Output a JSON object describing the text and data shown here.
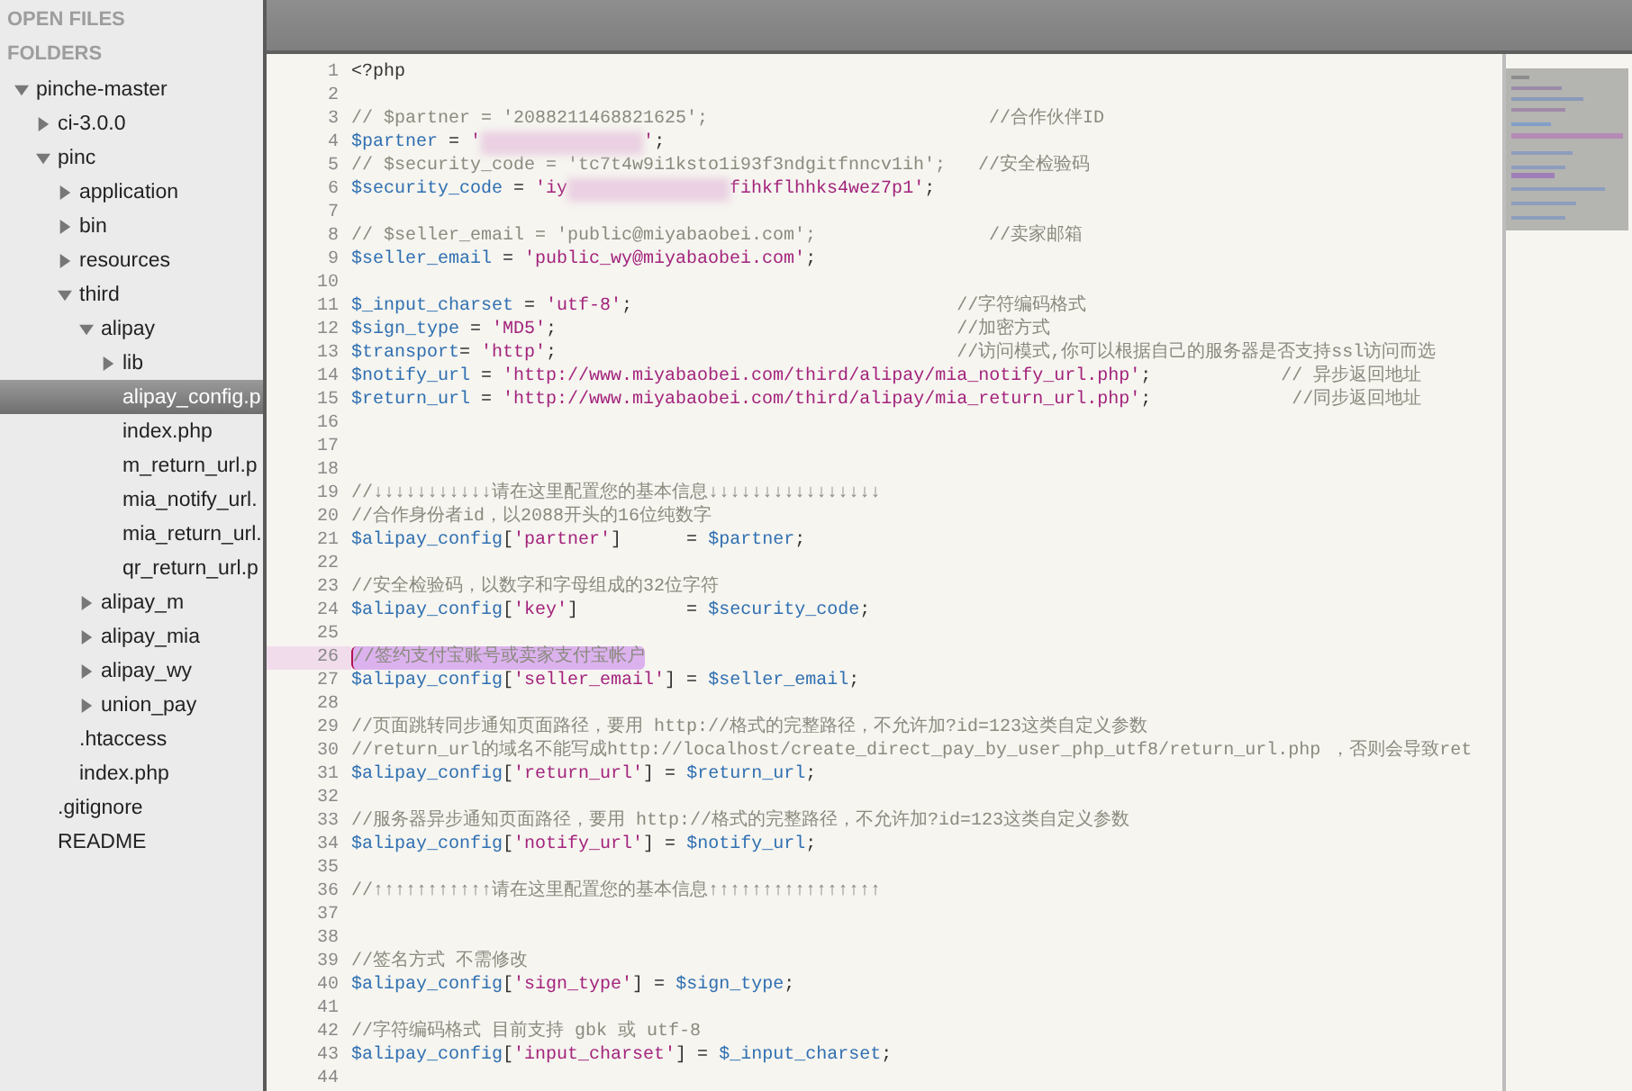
{
  "sidebar": {
    "sections": [
      {
        "label": "OPEN FILES"
      },
      {
        "label": "FOLDERS"
      }
    ],
    "tree": [
      {
        "name": "pinche-master",
        "kind": "folder",
        "expanded": true,
        "selected": false,
        "children": [
          {
            "name": "ci-3.0.0",
            "kind": "folder",
            "expanded": false,
            "selected": false
          },
          {
            "name": "pinc",
            "kind": "folder",
            "expanded": true,
            "selected": false,
            "children": [
              {
                "name": "application",
                "kind": "folder",
                "expanded": false,
                "selected": false
              },
              {
                "name": "bin",
                "kind": "folder",
                "expanded": false,
                "selected": false
              },
              {
                "name": "resources",
                "kind": "folder",
                "expanded": false,
                "selected": false
              },
              {
                "name": "third",
                "kind": "folder",
                "expanded": true,
                "selected": false,
                "children": [
                  {
                    "name": "alipay",
                    "kind": "folder",
                    "expanded": true,
                    "selected": false,
                    "children": [
                      {
                        "name": "lib",
                        "kind": "folder",
                        "expanded": false,
                        "selected": false
                      },
                      {
                        "name": "alipay_config.p",
                        "kind": "file",
                        "selected": true
                      },
                      {
                        "name": "index.php",
                        "kind": "file",
                        "selected": false
                      },
                      {
                        "name": "m_return_url.p",
                        "kind": "file",
                        "selected": false
                      },
                      {
                        "name": "mia_notify_url.",
                        "kind": "file",
                        "selected": false
                      },
                      {
                        "name": "mia_return_url.",
                        "kind": "file",
                        "selected": false
                      },
                      {
                        "name": "qr_return_url.p",
                        "kind": "file",
                        "selected": false
                      }
                    ]
                  },
                  {
                    "name": "alipay_m",
                    "kind": "folder",
                    "expanded": false,
                    "selected": false
                  },
                  {
                    "name": "alipay_mia",
                    "kind": "folder",
                    "expanded": false,
                    "selected": false
                  },
                  {
                    "name": "alipay_wy",
                    "kind": "folder",
                    "expanded": false,
                    "selected": false
                  },
                  {
                    "name": "union_pay",
                    "kind": "folder",
                    "expanded": false,
                    "selected": false
                  }
                ]
              },
              {
                "name": ".htaccess",
                "kind": "file",
                "selected": false
              },
              {
                "name": "index.php",
                "kind": "file",
                "selected": false
              }
            ]
          },
          {
            "name": ".gitignore",
            "kind": "file",
            "selected": false
          },
          {
            "name": "README",
            "kind": "file",
            "selected": false
          }
        ]
      }
    ]
  },
  "editor": {
    "lines": [
      {
        "number": "1",
        "selected": false,
        "tokens": [
          {
            "kind": "plain",
            "text": "<?php"
          }
        ]
      },
      {
        "number": "2",
        "selected": false
      },
      {
        "number": "3",
        "selected": false,
        "tokens": [
          {
            "kind": "comment",
            "text": "// $partner = '2088211468821625';                          //合作伙伴ID"
          }
        ]
      },
      {
        "number": "4",
        "selected": false,
        "tokens": [
          {
            "kind": "var",
            "text": "$partner"
          },
          {
            "kind": "plain",
            "text": " = "
          },
          {
            "kind": "string",
            "text": "'"
          },
          {
            "kind": "blur"
          },
          {
            "kind": "string",
            "text": "'"
          },
          {
            "kind": "plain",
            "text": ";"
          }
        ]
      },
      {
        "number": "5",
        "selected": false,
        "tokens": [
          {
            "kind": "comment",
            "text": "// $security_code = 'tc7t4w9i1ksto1i93f3ndgitfnncv1ih';   //安全检验码"
          }
        ]
      },
      {
        "number": "6",
        "selected": false,
        "tokens": [
          {
            "kind": "var",
            "text": "$security_code"
          },
          {
            "kind": "plain",
            "text": " = "
          },
          {
            "kind": "string",
            "text": "'iy"
          },
          {
            "kind": "blur"
          },
          {
            "kind": "string",
            "text": "fihkflhhks4wez7p1'"
          },
          {
            "kind": "plain",
            "text": ";"
          }
        ]
      },
      {
        "number": "7",
        "selected": false
      },
      {
        "number": "8",
        "selected": false,
        "tokens": [
          {
            "kind": "comment",
            "text": "// $seller_email = 'public@miyabaobei.com';                //卖家邮箱"
          }
        ]
      },
      {
        "number": "9",
        "selected": false,
        "tokens": [
          {
            "kind": "var",
            "text": "$seller_email"
          },
          {
            "kind": "plain",
            "text": " = "
          },
          {
            "kind": "string",
            "text": "'public_wy@miyabaobei.com'"
          },
          {
            "kind": "plain",
            "text": ";"
          }
        ]
      },
      {
        "number": "10",
        "selected": false
      },
      {
        "number": "11",
        "selected": false,
        "tokens": [
          {
            "kind": "var",
            "text": "$_input_charset"
          },
          {
            "kind": "plain",
            "text": " = "
          },
          {
            "kind": "string",
            "text": "'utf-8'"
          },
          {
            "kind": "plain",
            "text": ";                              "
          },
          {
            "kind": "comment",
            "text": "//字符编码格式"
          }
        ]
      },
      {
        "number": "12",
        "selected": false,
        "tokens": [
          {
            "kind": "var",
            "text": "$sign_type"
          },
          {
            "kind": "plain",
            "text": " = "
          },
          {
            "kind": "string",
            "text": "'MD5'"
          },
          {
            "kind": "plain",
            "text": ";                                     "
          },
          {
            "kind": "comment",
            "text": "//加密方式"
          }
        ]
      },
      {
        "number": "13",
        "selected": false,
        "tokens": [
          {
            "kind": "var",
            "text": "$transport"
          },
          {
            "kind": "plain",
            "text": "= "
          },
          {
            "kind": "string",
            "text": "'http'"
          },
          {
            "kind": "plain",
            "text": ";                                     "
          },
          {
            "kind": "comment",
            "text": "//访问模式,你可以根据自己的服务器是否支持ssl访问而选"
          }
        ]
      },
      {
        "number": "14",
        "selected": false,
        "tokens": [
          {
            "kind": "var",
            "text": "$notify_url"
          },
          {
            "kind": "plain",
            "text": " = "
          },
          {
            "kind": "string",
            "text": "'http://www.miyabaobei.com/third/alipay/mia_notify_url.php'"
          },
          {
            "kind": "plain",
            "text": ";            "
          },
          {
            "kind": "comment",
            "text": "// 异步返回地址"
          }
        ]
      },
      {
        "number": "15",
        "selected": false,
        "tokens": [
          {
            "kind": "var",
            "text": "$return_url"
          },
          {
            "kind": "plain",
            "text": " = "
          },
          {
            "kind": "string",
            "text": "'http://www.miyabaobei.com/third/alipay/mia_return_url.php'"
          },
          {
            "kind": "plain",
            "text": ";             "
          },
          {
            "kind": "comment",
            "text": "//同步返回地址"
          }
        ]
      },
      {
        "number": "16",
        "selected": false
      },
      {
        "number": "17",
        "selected": false
      },
      {
        "number": "18",
        "selected": false
      },
      {
        "number": "19",
        "selected": false,
        "tokens": [
          {
            "kind": "comment",
            "text": "//↓↓↓↓↓↓↓↓↓↓↓请在这里配置您的基本信息↓↓↓↓↓↓↓↓↓↓↓↓↓↓↓↓"
          }
        ]
      },
      {
        "number": "20",
        "selected": false,
        "tokens": [
          {
            "kind": "comment",
            "text": "//合作身份者id，以2088开头的16位纯数字"
          }
        ]
      },
      {
        "number": "21",
        "selected": false,
        "tokens": [
          {
            "kind": "var",
            "text": "$alipay_config"
          },
          {
            "kind": "plain",
            "text": "["
          },
          {
            "kind": "string",
            "text": "'partner'"
          },
          {
            "kind": "plain",
            "text": "]      = "
          },
          {
            "kind": "var",
            "text": "$partner"
          },
          {
            "kind": "plain",
            "text": ";"
          }
        ]
      },
      {
        "number": "22",
        "selected": false
      },
      {
        "number": "23",
        "selected": false,
        "tokens": [
          {
            "kind": "comment",
            "text": "//安全检验码，以数字和字母组成的32位字符"
          }
        ]
      },
      {
        "number": "24",
        "selected": false,
        "tokens": [
          {
            "kind": "var",
            "text": "$alipay_config"
          },
          {
            "kind": "plain",
            "text": "["
          },
          {
            "kind": "string",
            "text": "'key'"
          },
          {
            "kind": "plain",
            "text": "]          = "
          },
          {
            "kind": "var",
            "text": "$security_code"
          },
          {
            "kind": "plain",
            "text": ";"
          }
        ]
      },
      {
        "number": "25",
        "selected": false
      },
      {
        "number": "26",
        "selected": true,
        "tokens": [
          {
            "kind": "comment",
            "text": "//签约支付宝账号或卖家支付宝帐户"
          }
        ]
      },
      {
        "number": "27",
        "selected": false,
        "tokens": [
          {
            "kind": "var",
            "text": "$alipay_config"
          },
          {
            "kind": "plain",
            "text": "["
          },
          {
            "kind": "string",
            "text": "'seller_email'"
          },
          {
            "kind": "plain",
            "text": "] = "
          },
          {
            "kind": "var",
            "text": "$seller_email"
          },
          {
            "kind": "plain",
            "text": ";"
          }
        ]
      },
      {
        "number": "28",
        "selected": false
      },
      {
        "number": "29",
        "selected": false,
        "tokens": [
          {
            "kind": "comment",
            "text": "//页面跳转同步通知页面路径，要用 http://格式的完整路径，不允许加?id=123这类自定义参数"
          }
        ]
      },
      {
        "number": "30",
        "selected": false,
        "tokens": [
          {
            "kind": "comment",
            "text": "//return_url的域名不能写成http://localhost/create_direct_pay_by_user_php_utf8/return_url.php ，否则会导致ret"
          }
        ]
      },
      {
        "number": "31",
        "selected": false,
        "tokens": [
          {
            "kind": "var",
            "text": "$alipay_config"
          },
          {
            "kind": "plain",
            "text": "["
          },
          {
            "kind": "string",
            "text": "'return_url'"
          },
          {
            "kind": "plain",
            "text": "] = "
          },
          {
            "kind": "var",
            "text": "$return_url"
          },
          {
            "kind": "plain",
            "text": ";"
          }
        ]
      },
      {
        "number": "32",
        "selected": false
      },
      {
        "number": "33",
        "selected": false,
        "tokens": [
          {
            "kind": "comment",
            "text": "//服务器异步通知页面路径，要用 http://格式的完整路径，不允许加?id=123这类自定义参数"
          }
        ]
      },
      {
        "number": "34",
        "selected": false,
        "tokens": [
          {
            "kind": "var",
            "text": "$alipay_config"
          },
          {
            "kind": "plain",
            "text": "["
          },
          {
            "kind": "string",
            "text": "'notify_url'"
          },
          {
            "kind": "plain",
            "text": "] = "
          },
          {
            "kind": "var",
            "text": "$notify_url"
          },
          {
            "kind": "plain",
            "text": ";"
          }
        ]
      },
      {
        "number": "35",
        "selected": false
      },
      {
        "number": "36",
        "selected": false,
        "tokens": [
          {
            "kind": "comment",
            "text": "//↑↑↑↑↑↑↑↑↑↑↑请在这里配置您的基本信息↑↑↑↑↑↑↑↑↑↑↑↑↑↑↑↑"
          }
        ]
      },
      {
        "number": "37",
        "selected": false
      },
      {
        "number": "38",
        "selected": false
      },
      {
        "number": "39",
        "selected": false,
        "tokens": [
          {
            "kind": "comment",
            "text": "//签名方式 不需修改"
          }
        ]
      },
      {
        "number": "40",
        "selected": false,
        "tokens": [
          {
            "kind": "var",
            "text": "$alipay_config"
          },
          {
            "kind": "plain",
            "text": "["
          },
          {
            "kind": "string",
            "text": "'sign_type'"
          },
          {
            "kind": "plain",
            "text": "] = "
          },
          {
            "kind": "var",
            "text": "$sign_type"
          },
          {
            "kind": "plain",
            "text": ";"
          }
        ]
      },
      {
        "number": "41",
        "selected": false
      },
      {
        "number": "42",
        "selected": false,
        "tokens": [
          {
            "kind": "comment",
            "text": "//字符编码格式 目前支持 gbk 或 utf-8"
          }
        ]
      },
      {
        "number": "43",
        "selected": false,
        "tokens": [
          {
            "kind": "var",
            "text": "$alipay_config"
          },
          {
            "kind": "plain",
            "text": "["
          },
          {
            "kind": "string",
            "text": "'input_charset'"
          },
          {
            "kind": "plain",
            "text": "] = "
          },
          {
            "kind": "var",
            "text": "$_input_charset"
          },
          {
            "kind": "plain",
            "text": ";"
          }
        ]
      },
      {
        "number": "44",
        "selected": false
      }
    ]
  }
}
